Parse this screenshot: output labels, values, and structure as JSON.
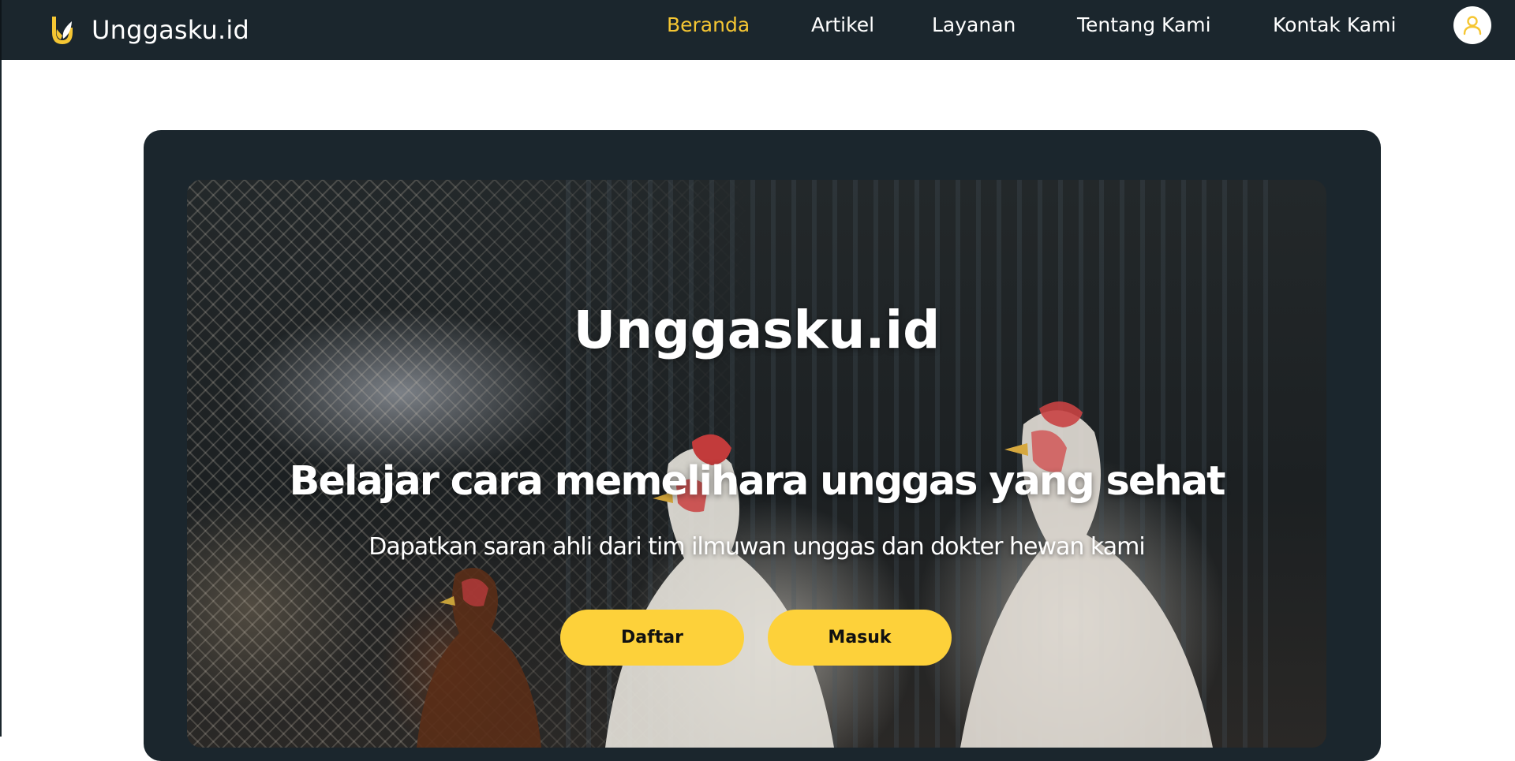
{
  "navbar": {
    "brand_name": "Unggasku.id",
    "links": [
      {
        "label": "Beranda",
        "active": true
      },
      {
        "label": "Artikel",
        "active": false
      },
      {
        "label": "Layanan",
        "active": false
      },
      {
        "label": "Tentang Kami",
        "active": false
      },
      {
        "label": "Kontak Kami",
        "active": false
      }
    ],
    "user_icon": "user-icon"
  },
  "hero": {
    "title": "Unggasku.id",
    "heading": "Belajar cara memelihara  unggas yang sehat",
    "subtitle": "Dapatkan saran ahli dari tim ilmuwan unggas dan dokter hewan kami",
    "buttons": {
      "register": "Daftar",
      "login": "Masuk"
    }
  },
  "colors": {
    "navbar_bg": "#1b262d",
    "accent": "#fdd13a",
    "active_link": "#f5c633",
    "text_light": "#ffffff"
  }
}
